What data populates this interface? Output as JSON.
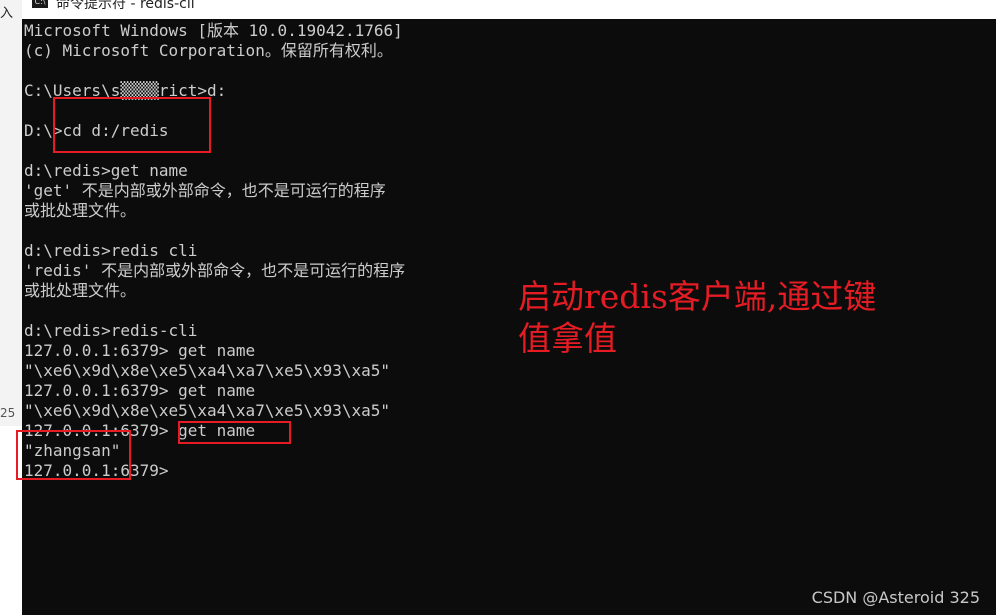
{
  "left_strip": {
    "top_text": "入",
    "side_number": "25"
  },
  "window": {
    "icon_text": "C:\\",
    "title": "命令提示符 - redis-cli"
  },
  "terminal": {
    "lines": [
      "Microsoft Windows [版本 10.0.19042.1766]",
      "(c) Microsoft Corporation。保留所有权利。",
      "",
      "C:\\Users\\s▒▒▒▒rict>d:",
      "",
      "D:\\>cd d:/redis",
      "",
      "d:\\redis>get name",
      "'get' 不是内部或外部命令，也不是可运行的程序",
      "或批处理文件。",
      "",
      "d:\\redis>redis cli",
      "'redis' 不是内部或外部命令，也不是可运行的程序",
      "或批处理文件。",
      "",
      "d:\\redis>redis-cli",
      "127.0.0.1:6379> get name",
      "\"\\xe6\\x9d\\x8e\\xe5\\xa4\\xa7\\xe5\\x93\\xa5\"",
      "127.0.0.1:6379> get name",
      "\"\\xe6\\x9d\\x8e\\xe5\\xa4\\xa7\\xe5\\x93\\xa5\"",
      "127.0.0.1:6379> get name",
      "\"zhangsan\"",
      "127.0.0.1:6379>"
    ]
  },
  "annotation": {
    "line1": "启动redis客户端,通过键",
    "line2": "值拿值"
  },
  "watermark": "CSDN @Asteroid 325",
  "colors": {
    "console_bg": "#0c0c0c",
    "console_text": "#cccccc",
    "annotation_red": "#e51c23"
  }
}
